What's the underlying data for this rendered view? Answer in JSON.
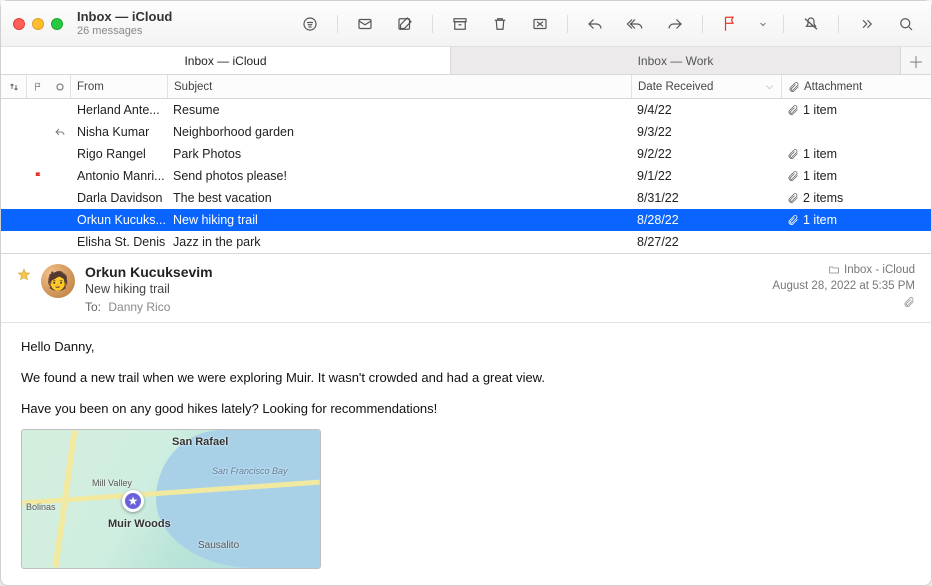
{
  "window": {
    "title": "Inbox — iCloud",
    "subtitle": "26 messages"
  },
  "tabs": {
    "active": "Inbox — iCloud",
    "inactive": "Inbox — Work"
  },
  "columns": {
    "from": "From",
    "subject": "Subject",
    "date": "Date Received",
    "attachment": "Attachment"
  },
  "messages": [
    {
      "from": "Herland Ante...",
      "subject": "Resume",
      "date": "9/4/22",
      "attachment": "1 item",
      "flagged": false,
      "replied": false,
      "selected": false
    },
    {
      "from": "Nisha Kumar",
      "subject": "Neighborhood garden",
      "date": "9/3/22",
      "attachment": "",
      "flagged": false,
      "replied": true,
      "selected": false
    },
    {
      "from": "Rigo Rangel",
      "subject": "Park Photos",
      "date": "9/2/22",
      "attachment": "1 item",
      "flagged": false,
      "replied": false,
      "selected": false
    },
    {
      "from": "Antonio Manri...",
      "subject": "Send photos please!",
      "date": "9/1/22",
      "attachment": "1 item",
      "flagged": true,
      "replied": false,
      "selected": false
    },
    {
      "from": "Darla Davidson",
      "subject": "The best vacation",
      "date": "8/31/22",
      "attachment": "2 items",
      "flagged": false,
      "replied": false,
      "selected": false
    },
    {
      "from": "Orkun Kucuks...",
      "subject": "New hiking trail",
      "date": "8/28/22",
      "attachment": "1 item",
      "flagged": false,
      "replied": false,
      "selected": true
    },
    {
      "from": "Elisha St. Denis",
      "subject": "Jazz in the park",
      "date": "8/27/22",
      "attachment": "",
      "flagged": false,
      "replied": false,
      "selected": false
    }
  ],
  "detail": {
    "sender": "Orkun Kucuksevim",
    "subject": "New hiking trail",
    "to_label": "To:",
    "to_value": "Danny Rico",
    "folder": "Inbox - iCloud",
    "timestamp": "August 28, 2022 at 5:35 PM",
    "body": {
      "p1": "Hello Danny,",
      "p2": "We found a new trail when we were exploring Muir. It wasn't crowded and had a great view.",
      "p3": "Have you been on any good hikes lately? Looking for recommendations!"
    },
    "map": {
      "pin_label": "Muir Woods",
      "labels": {
        "san_rafael": "San Rafael",
        "sausalito": "Sausalito",
        "mill_valley": "Mill Valley",
        "bolinas": "Bolinas",
        "san_francisco_bay": "San Francisco Bay"
      }
    }
  }
}
